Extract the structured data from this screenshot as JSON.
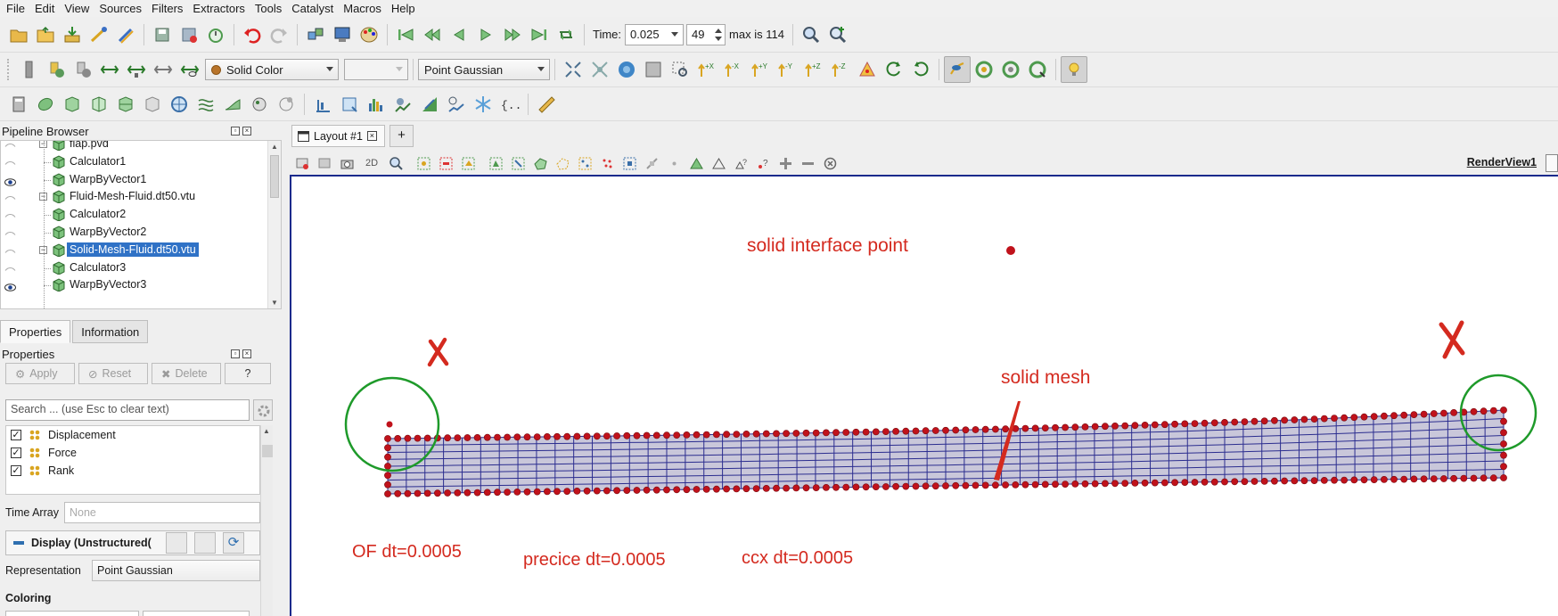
{
  "menu": [
    "File",
    "Edit",
    "View",
    "Sources",
    "Filters",
    "Extractors",
    "Tools",
    "Catalyst",
    "Macros",
    "Help"
  ],
  "toolbar": {
    "time_label": "Time:",
    "time_value": "0.025",
    "step_value": "49",
    "max_label": "max is 114",
    "solid_color": "Solid Color",
    "point_gaussian": "Point Gaussian",
    "rotate_plus90": "+90",
    "rotate_minus90": "-90"
  },
  "pipeline": {
    "title": "Pipeline Browser",
    "items": [
      {
        "label": "flap.pvd",
        "depth": 0,
        "eye": false,
        "expander": true
      },
      {
        "label": "Calculator1",
        "depth": 1,
        "eye": false
      },
      {
        "label": "WarpByVector1",
        "depth": 1,
        "eye": true
      },
      {
        "label": "Fluid-Mesh-Fluid.dt50.vtu",
        "depth": 0,
        "eye": false,
        "expander": true
      },
      {
        "label": "Calculator2",
        "depth": 1,
        "eye": false
      },
      {
        "label": "WarpByVector2",
        "depth": 1,
        "eye": false
      },
      {
        "label": "Solid-Mesh-Fluid.dt50.vtu",
        "depth": 0,
        "eye": false,
        "expander": true,
        "selected": true
      },
      {
        "label": "Calculator3",
        "depth": 1,
        "eye": false
      },
      {
        "label": "WarpByVector3",
        "depth": 1,
        "eye": true
      }
    ]
  },
  "tabs": {
    "properties": "Properties",
    "information": "Information"
  },
  "properties": {
    "title": "Properties",
    "apply": "Apply",
    "reset": "Reset",
    "delete": "Delete",
    "help": "?",
    "search_placeholder": "Search ... (use Esc to clear text)",
    "arrays": [
      "Displacement",
      "Force",
      "Rank"
    ],
    "time_array_label": "Time Array",
    "time_array_value": "None",
    "display_label": "Display (Unstructured(",
    "representation_label": "Representation",
    "representation_value": "Point Gaussian",
    "coloring_label": "Coloring"
  },
  "view": {
    "layout_tab": "Layout #1",
    "mode_2d": "2D",
    "render_view": "RenderView1",
    "annotations": {
      "interface_point": "solid interface point",
      "solid_mesh": "solid mesh",
      "of_dt": "OF dt=0.0005",
      "precice_dt": "precice dt=0.0005",
      "ccx_dt": "ccx dt=0.0005"
    },
    "mesh": {
      "columns": 60,
      "rows": 8
    }
  },
  "colors": {
    "annotation_red": "#d42a1f",
    "circle_green": "#1e9a2a",
    "mesh_fill": "#c9c7da",
    "mesh_lines": "#2b2d8f",
    "point_red": "#c0121b",
    "selection_blue": "#3072c6",
    "viewport_border": "#1a2a8c"
  }
}
